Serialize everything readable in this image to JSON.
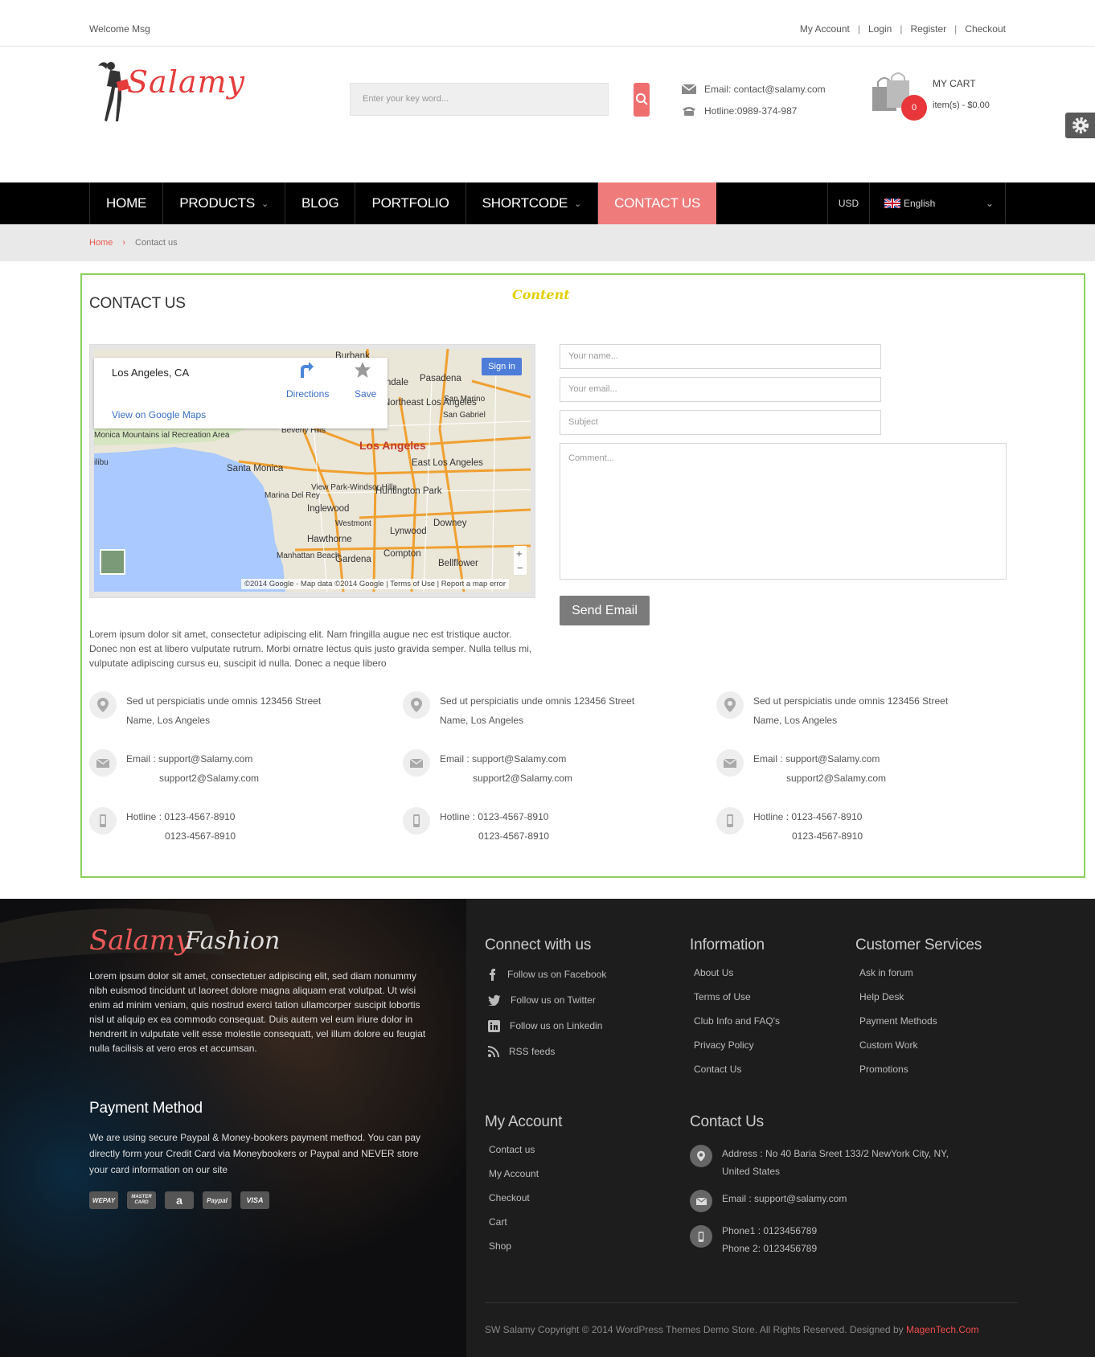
{
  "topbar": {
    "welcome": "Welcome Msg",
    "links": [
      "My Account",
      "Login",
      "Register",
      "Checkout"
    ]
  },
  "header": {
    "logo_text": "Salamy",
    "search_placeholder": "Enter your key word...",
    "email": "Email: contact@salamy.com",
    "hotline": "Hotline:0989-374-987",
    "cart_label": "MY CART",
    "cart_items": "item(s) - $0.00",
    "cart_count": "0"
  },
  "nav": {
    "items": [
      "HOME",
      "PRODUCTS",
      "BLOG",
      "PORTFOLIO",
      "SHORTCODE",
      "CONTACT US"
    ],
    "currency": "USD",
    "language": "English"
  },
  "breadcrumb": {
    "home": "Home",
    "current": "Contact us"
  },
  "content": {
    "tag": "Content",
    "title": "CONTACT US",
    "map": {
      "city": "Los Angeles, CA",
      "directions": "Directions",
      "save": "Save",
      "view_link": "View on Google Maps",
      "signin": "Sign in",
      "footer": "©2014 Google - Map data ©2014 Google  |  Terms of Use  |  Report a map error",
      "labels": [
        "Burbank",
        "Glendale",
        "Pasadena",
        "Northeast Los Angeles",
        "San Marino",
        "San Gabriel",
        "Beverly Hills",
        "Los Angeles",
        "East Los Angeles",
        "Santa Monica",
        "View Park-Windsor Hills",
        "Marina Del Rey",
        "Huntington Park",
        "Inglewood",
        "Westmont",
        "Lynwood",
        "Downey",
        "Hawthorne",
        "Manhattan Beach",
        "Gardena",
        "Compton",
        "Bellflower",
        "Monica Mountains ial Recreation Area",
        "ilibu"
      ]
    },
    "form": {
      "name_ph": "Your name...",
      "email_ph": "Your email...",
      "subject_ph": "Subject",
      "comment_ph": "Comment...",
      "send": "Send Email"
    },
    "lorem": "Lorem ipsum dolor sit amet, consectetur adipiscing elit. Nam fringilla augue nec est tristique auctor. Donec non est at libero vulputate rutrum. Morbi ornatre lectus quis justo gravida semper. Nulla tellus mi, vulputate adipiscing cursus eu, suscipit id nulla. Donec a neque libero",
    "addresses": [
      {
        "addr1": "Sed ut perspiciatis unde omnis 123456 Street",
        "addr2": "Name, Los Angeles",
        "email1": "Email : support@Salamy.com",
        "email2": "support2@Salamy.com",
        "hot1": "Hotline : 0123-4567-8910",
        "hot2": "0123-4567-8910"
      },
      {
        "addr1": "Sed ut perspiciatis unde omnis 123456 Street",
        "addr2": "Name, Los Angeles",
        "email1": "Email : support@Salamy.com",
        "email2": "support2@Salamy.com",
        "hot1": "Hotline : 0123-4567-8910",
        "hot2": "0123-4567-8910"
      },
      {
        "addr1": "Sed ut perspiciatis unde omnis 123456 Street",
        "addr2": "Name, Los Angeles",
        "email1": "Email : support@Salamy.com",
        "email2": "support2@Salamy.com",
        "hot1": "Hotline : 0123-4567-8910",
        "hot2": "0123-4567-8910"
      }
    ]
  },
  "footer": {
    "logo1": "Salamy",
    "logo2": "Fashion",
    "about": "Lorem ipsum dolor sit amet, consectetuer adipiscing elit, sed diam nonummy nibh euismod tincidunt ut laoreet dolore magna aliquam erat volutpat. Ut wisi enim ad minim veniam, quis nostrud exerci tation ullamcorper suscipit lobortis nisl ut aliquip ex ea commodo consequat. Duis autem vel eum iriure dolor in hendrerit in vulputate velit esse molestie consequatt, vel illum dolore eu feugiat nulla facilisis at vero eros et accumsan.",
    "payment_title": "Payment Method",
    "payment_text": "We are using secure Paypal & Money-bookers payment method. You can pay directly form your Credit Card via Moneybookers or Paypal and NEVER store your card information on our site",
    "cards": [
      "WEPAY",
      "MASTER CARD",
      "a",
      "Paypal",
      "VISA"
    ],
    "connect_title": "Connect with us",
    "connect": [
      "Follow us on Facebook",
      "Follow us on Twitter",
      "Follow us on Linkedin",
      "RSS feeds"
    ],
    "info_title": "Information",
    "info": [
      "About Us",
      "Terms of Use",
      "Club Info and FAQ's",
      "Privacy Policy",
      "Contact Us"
    ],
    "cs_title": "Customer Services",
    "cs": [
      "Ask in forum",
      "Help Desk",
      "Payment Methods",
      "Custom Work",
      "Promotions"
    ],
    "account_title": "My Account",
    "account": [
      "Contact us",
      "My Account",
      "Checkout",
      "Cart",
      "Shop"
    ],
    "contact_title": "Contact Us",
    "contact_address1": "Address : No 40 Baria Sreet 133/2 NewYork City, NY,",
    "contact_address2": "United States",
    "contact_email": "Email : support@salamy.com",
    "contact_phone1": "Phone1 : 0123456789",
    "contact_phone2": "Phone 2: 0123456789",
    "copyright": "SW Salamy Copyright © 2014 WordPress Themes Demo Store. All Rights Reserved. Designed by ",
    "designer": "MagenTech.Com"
  }
}
